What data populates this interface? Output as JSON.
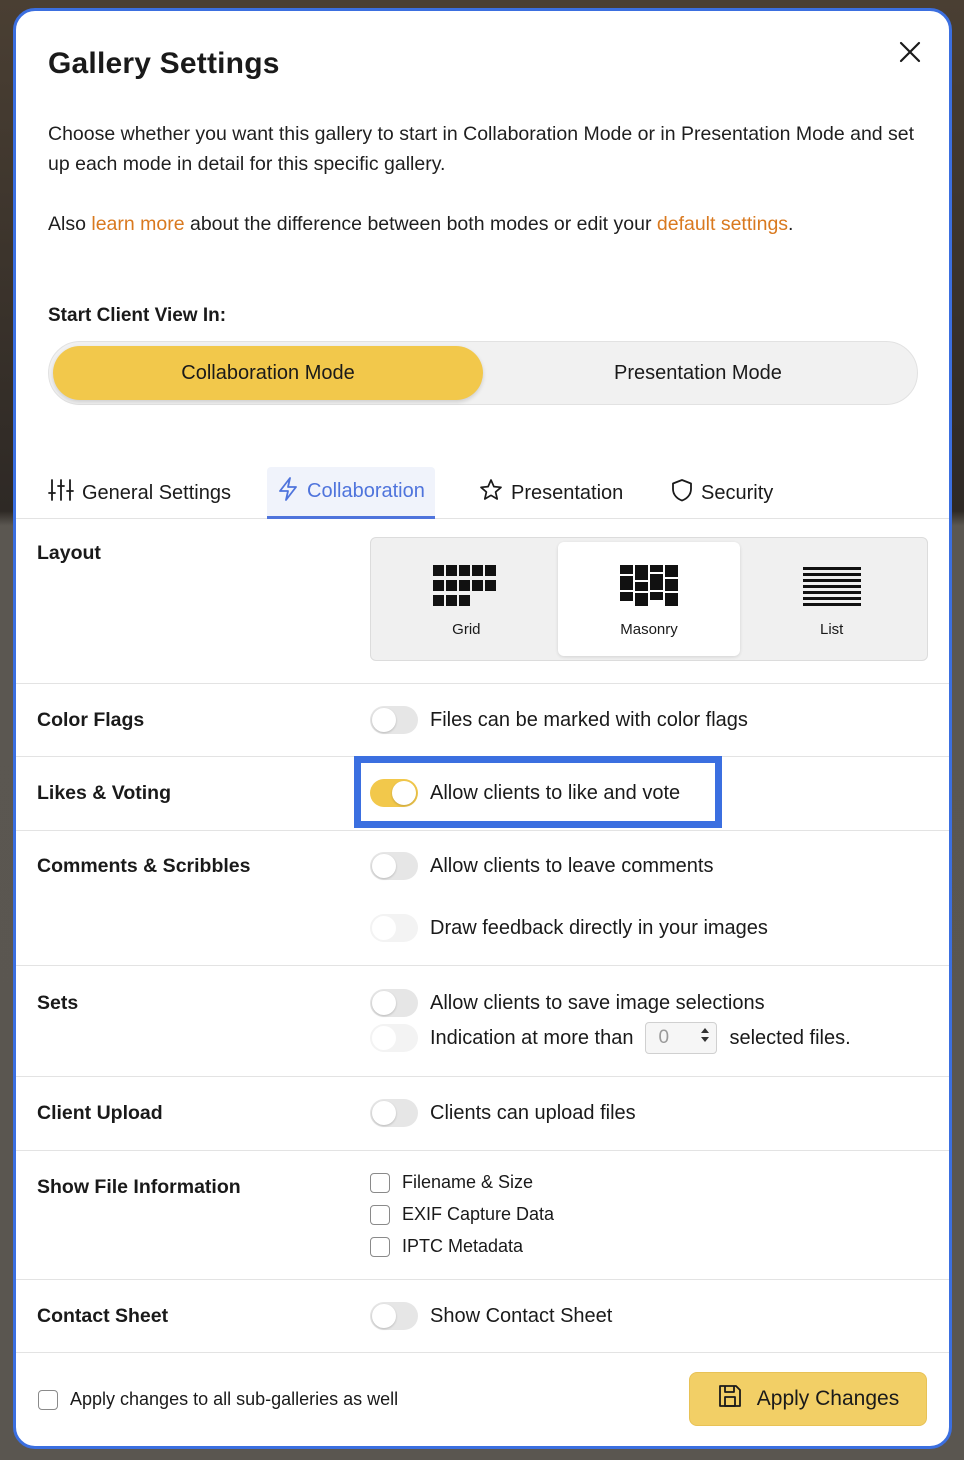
{
  "dialog": {
    "title": "Gallery Settings",
    "description": "Choose whether you want this gallery to start in Collaboration Mode or in Presentation Mode and set up each mode in detail for this specific gallery.",
    "also_prefix": "Also ",
    "learn_more_link": "learn more",
    "also_middle": " about the difference between both modes or edit your ",
    "default_settings_link": "default settings",
    "also_suffix": "."
  },
  "start_view": {
    "label": "Start Client View In:",
    "options": [
      "Collaboration Mode",
      "Presentation Mode"
    ],
    "selected": "Collaboration Mode"
  },
  "tabs": [
    {
      "label": "General Settings",
      "icon": "sliders-icon"
    },
    {
      "label": "Collaboration",
      "icon": "lightning-icon",
      "active": true
    },
    {
      "label": "Presentation",
      "icon": "star-icon"
    },
    {
      "label": "Security",
      "icon": "shield-icon"
    }
  ],
  "layout": {
    "label": "Layout",
    "options": [
      {
        "label": "Grid",
        "icon": "grid-icon"
      },
      {
        "label": "Masonry",
        "icon": "masonry-icon",
        "active": true
      },
      {
        "label": "List",
        "icon": "list-icon"
      }
    ]
  },
  "color_flags": {
    "label": "Color Flags",
    "toggle_text": "Files can be marked with color flags",
    "on": false
  },
  "likes": {
    "label": "Likes & Voting",
    "toggle_text": "Allow clients to like and vote",
    "on": true
  },
  "comments": {
    "label": "Comments & Scribbles",
    "toggle1_text": "Allow clients to leave comments",
    "toggle2_text": "Draw feedback directly in your images"
  },
  "sets": {
    "label": "Sets",
    "toggle1_text": "Allow clients to save image selections",
    "indication_prefix": "Indication at more than",
    "indication_value": "0",
    "indication_suffix": "selected files."
  },
  "client_upload": {
    "label": "Client Upload",
    "toggle_text": "Clients can upload files"
  },
  "file_info": {
    "label": "Show File Information",
    "options": [
      "Filename & Size",
      "EXIF Capture Data",
      "IPTC Metadata"
    ]
  },
  "contact_sheet": {
    "label": "Contact Sheet",
    "toggle_text": "Show Contact Sheet"
  },
  "footer": {
    "subgalleries_label": "Apply changes to all sub-galleries as well",
    "apply_button": "Apply Changes"
  },
  "colors": {
    "accent_yellow": "#f2c84b",
    "link_orange": "#d9791f",
    "tab_blue": "#4f74dc",
    "highlight_blue": "#3b6fe0"
  }
}
